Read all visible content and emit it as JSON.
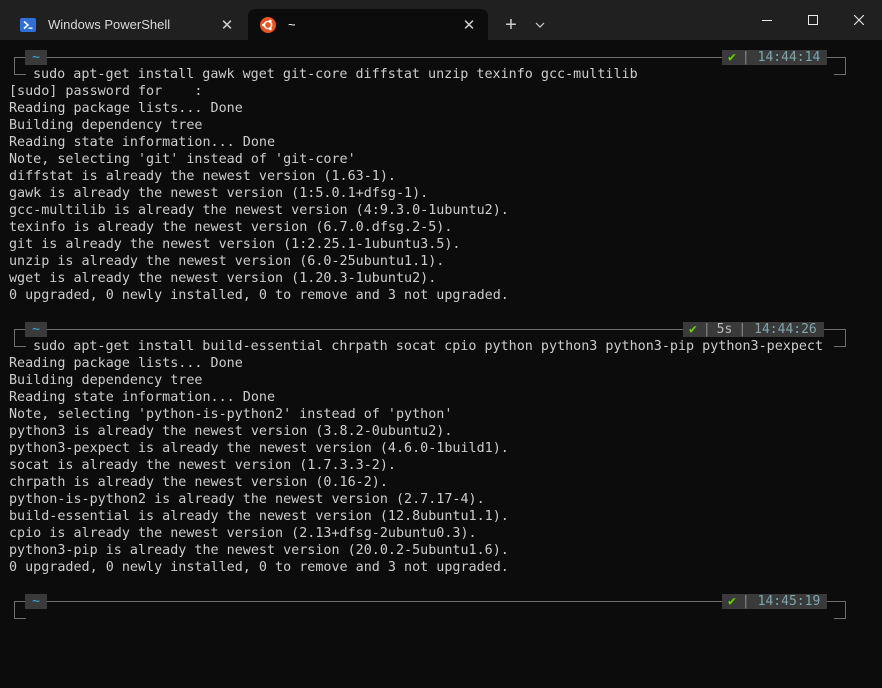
{
  "tabs": [
    {
      "label": "Windows PowerShell",
      "icon": "powershell-icon"
    },
    {
      "label": "~",
      "icon": "ubuntu-icon"
    }
  ],
  "titlebar": {
    "new_tab": "+",
    "dropdown_icon": "chevron-down-icon"
  },
  "prompts": [
    {
      "dir": "~",
      "check": "✔",
      "duration": "",
      "sep": "|",
      "time": "14:44:14"
    },
    {
      "dir": "~",
      "check": "✔",
      "duration": "5s",
      "sep": "|",
      "time": "14:44:26"
    },
    {
      "dir": "~",
      "check": "✔",
      "duration": "",
      "sep": "|",
      "time": "14:45:19"
    }
  ],
  "block1": {
    "command": "sudo apt-get install gawk wget git-core diffstat unzip texinfo gcc-multilib",
    "output": [
      "[sudo] password for    :",
      "Reading package lists... Done",
      "Building dependency tree",
      "Reading state information... Done",
      "Note, selecting 'git' instead of 'git-core'",
      "diffstat is already the newest version (1.63-1).",
      "gawk is already the newest version (1:5.0.1+dfsg-1).",
      "gcc-multilib is already the newest version (4:9.3.0-1ubuntu2).",
      "texinfo is already the newest version (6.7.0.dfsg.2-5).",
      "git is already the newest version (1:2.25.1-1ubuntu3.5).",
      "unzip is already the newest version (6.0-25ubuntu1.1).",
      "wget is already the newest version (1.20.3-1ubuntu2).",
      "0 upgraded, 0 newly installed, 0 to remove and 3 not upgraded."
    ]
  },
  "block2": {
    "command": "sudo apt-get install build-essential chrpath socat cpio python python3 python3-pip python3-pexpect",
    "output": [
      "Reading package lists... Done",
      "Building dependency tree",
      "Reading state information... Done",
      "Note, selecting 'python-is-python2' instead of 'python'",
      "python3 is already the newest version (3.8.2-0ubuntu2).",
      "python3-pexpect is already the newest version (4.6.0-1build1).",
      "socat is already the newest version (1.7.3.3-2).",
      "chrpath is already the newest version (0.16-2).",
      "python-is-python2 is already the newest version (2.7.17-4).",
      "build-essential is already the newest version (12.8ubuntu1.1).",
      "cpio is already the newest version (2.13+dfsg-2ubuntu0.3).",
      "python3-pip is already the newest version (20.0.2-5ubuntu1.6).",
      "0 upgraded, 0 newly installed, 0 to remove and 3 not upgraded."
    ]
  }
}
